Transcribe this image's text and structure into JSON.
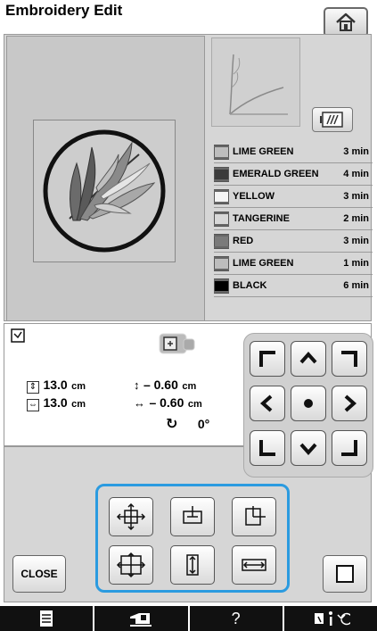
{
  "header": {
    "title": "Embroidery Edit",
    "home_icon": "home-icon"
  },
  "preview": {
    "button_icon": "needle-preview-icon"
  },
  "threads": [
    {
      "name": "LIME GREEN",
      "time": "3 min",
      "color": "#bdbdbd"
    },
    {
      "name": "EMERALD GREEN",
      "time": "4 min",
      "color": "#3a3a3a"
    },
    {
      "name": "YELLOW",
      "time": "3 min",
      "color": "#f4f4f4"
    },
    {
      "name": "TANGERINE",
      "time": "2 min",
      "color": "#d8d8d8"
    },
    {
      "name": "RED",
      "time": "3 min",
      "color": "#7a7a7a"
    },
    {
      "name": "LIME GREEN",
      "time": "1 min",
      "color": "#bdbdbd"
    },
    {
      "name": "BLACK",
      "time": "6 min",
      "color": "#000000"
    }
  ],
  "size": {
    "height": "13.0",
    "width": "13.0",
    "unit": "cm"
  },
  "info": {
    "height": "13.0",
    "width": "13.0",
    "unit": "cm",
    "vertical_offset": "– 0.60",
    "horizontal_offset": "– 0.60",
    "offset_unit": "cm",
    "rotation": "0°"
  },
  "buttons": {
    "close_label": "CLOSE",
    "help_label": "?"
  }
}
